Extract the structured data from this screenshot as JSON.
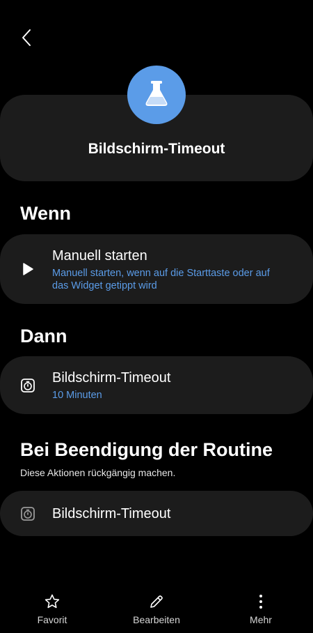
{
  "header": {
    "back_icon": "chevron-left-icon"
  },
  "routine": {
    "icon": "flask-icon",
    "icon_color": "#5b9ce8",
    "name": "Bildschirm-Timeout"
  },
  "sections": {
    "wenn": {
      "heading": "Wenn",
      "card": {
        "icon": "play-icon",
        "title": "Manuell starten",
        "subtitle": "Manuell starten, wenn auf die Starttaste oder auf das Widget getippt wird"
      }
    },
    "dann": {
      "heading": "Dann",
      "card": {
        "icon": "timer-icon",
        "title": "Bildschirm-Timeout",
        "subtitle": "10 Minuten"
      }
    },
    "ende": {
      "heading": "Bei Beendigung der Routine",
      "subheading": "Diese Aktionen rückgängig machen.",
      "card": {
        "icon": "timer-icon",
        "title": "Bildschirm-Timeout"
      }
    }
  },
  "bottom_nav": {
    "favorite": {
      "icon": "star-icon",
      "label": "Favorit"
    },
    "edit": {
      "icon": "pencil-icon",
      "label": "Bearbeiten"
    },
    "more": {
      "icon": "more-vertical-icon",
      "label": "Mehr"
    }
  },
  "colors": {
    "background": "#000000",
    "card": "#1c1c1c",
    "accent": "#5b9ce8"
  }
}
